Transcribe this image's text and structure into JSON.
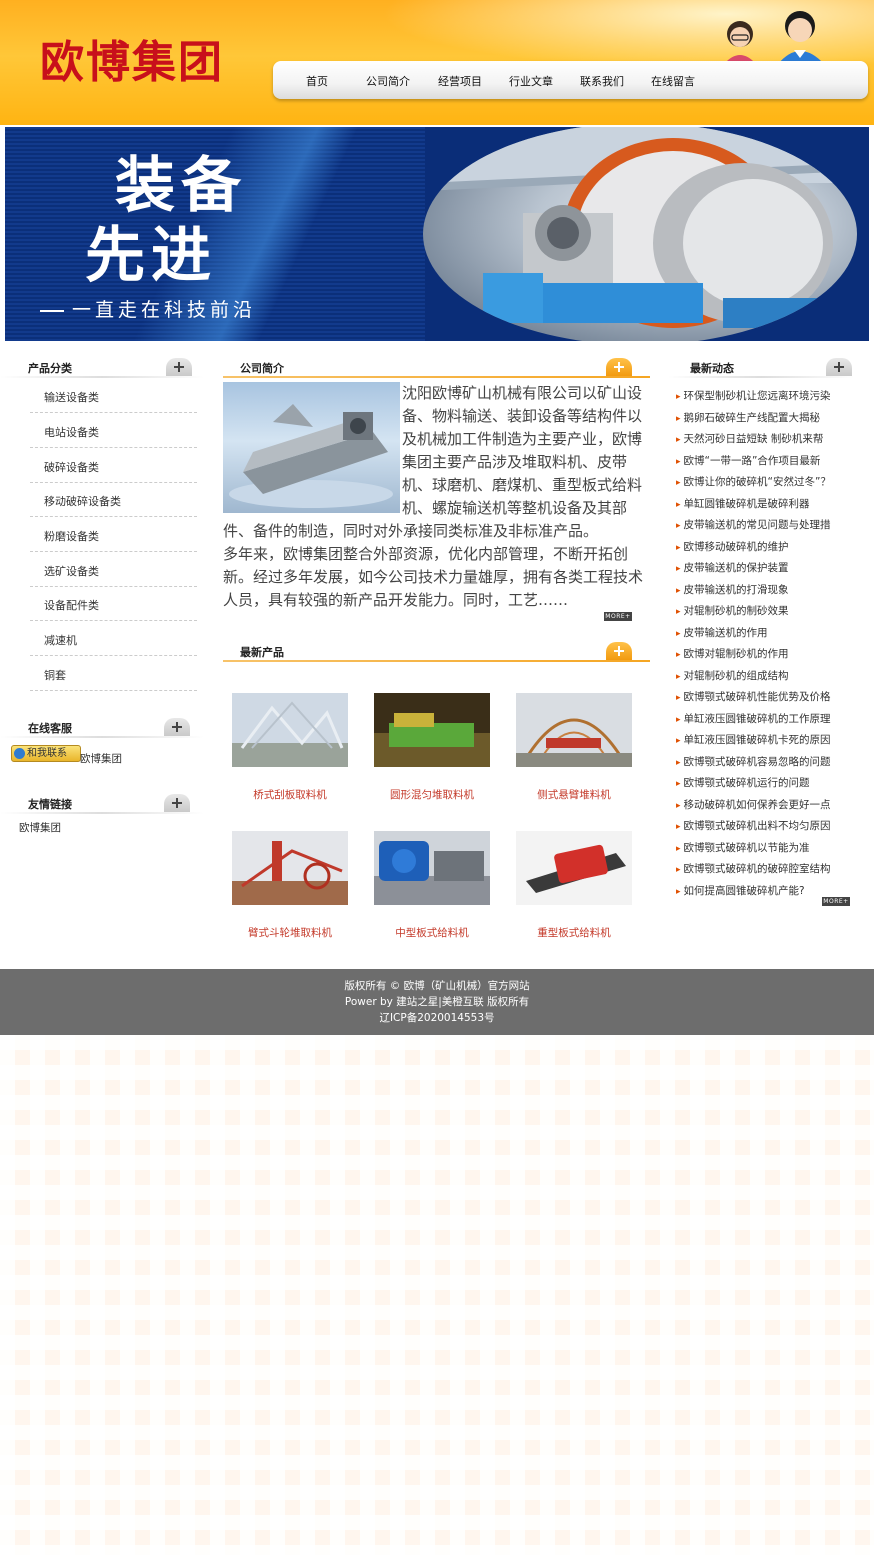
{
  "header": {
    "logo": "欧博集团",
    "nav": [
      "首页",
      "公司简介",
      "经营项目",
      "行业文章",
      "联系我们",
      "在线留言"
    ]
  },
  "banner": {
    "line1": "装备",
    "line2": "先进",
    "line3": "一直走在科技前沿"
  },
  "left": {
    "categories_title": "产品分类",
    "categories": [
      "输送设备类",
      "电站设备类",
      "破碎设备类",
      "移动破碎设备类",
      "粉磨设备类",
      "选矿设备类",
      "设备配件类",
      "减速机",
      "铜套"
    ],
    "service_title": "在线客服",
    "service_badge": "和我联系",
    "service_name": "欧博集团",
    "links_title": "友情链接",
    "links": [
      "欧博集团"
    ]
  },
  "main": {
    "intro_title": "公司简介",
    "intro_text": "沈阳欧博矿山机械有限公司以矿山设备、物料输送、装卸设备等结构件以及机械加工件制造为主要产业，欧博集团主要产品涉及堆取料机、皮带机、球磨机、磨煤机、重型板式给料机、螺旋输送机等整机设备及其部件、备件的制造，同时对外承接同类标准及非标准产品。",
    "intro_text2": "多年来，欧博集团整合外部资源，优化内部管理，不断开拓创新。经过多年发展，如今公司技术力量雄厚，拥有各类工程技术人员，具有较强的新产品开发能力。同时，工艺……",
    "more_label": "MORE+",
    "products_title": "最新产品",
    "products": [
      {
        "name": "桥式刮板取料机"
      },
      {
        "name": "圆形混匀堆取料机"
      },
      {
        "name": "侧式悬臂堆料机"
      },
      {
        "name": "臂式斗轮堆取料机"
      },
      {
        "name": "中型板式给料机"
      },
      {
        "name": "重型板式给料机"
      }
    ]
  },
  "right": {
    "news_title": "最新动态",
    "news": [
      "环保型制砂机让您远离环境污染",
      "鹅卵石破碎生产线配置大揭秘",
      "天然河砂日益短缺 制砂机来帮",
      "欧博“一带一路”合作项目最新",
      "欧博让你的破碎机“安然过冬”？",
      "单缸圆锥破碎机是破碎利器",
      "皮带输送机的常见问题与处理措",
      "欧博移动破碎机的维护",
      "皮带输送机的保护装置",
      "皮带输送机的打滑现象",
      "对辊制砂机的制砂效果",
      "皮带输送机的作用",
      "欧博对辊制砂机的作用",
      "对辊制砂机的组成结构",
      "欧博颚式破碎机性能优势及价格",
      "单缸液压圆锥破碎机的工作原理",
      "单缸液压圆锥破碎机卡死的原因",
      "欧博颚式破碎机容易忽略的问题",
      "欧博颚式破碎机运行的问题",
      "移动破碎机如何保养会更好一点",
      "欧博颚式破碎机出料不均匀原因",
      "欧博颚式破碎机以节能为准",
      "欧博颚式破碎机的破碎腔室结构",
      "如何提高圆锥破碎机产能?"
    ],
    "more_label": "MORE+"
  },
  "footer": {
    "line1": "版权所有 © 欧博（矿山机械）官方网站",
    "line2": "Power by 建站之星|美橙互联 版权所有",
    "line3": "辽ICP备2020014553号"
  },
  "colors": {
    "accent": "#f29a10",
    "logo": "#c8101b",
    "footer": "#6d6d6d"
  }
}
